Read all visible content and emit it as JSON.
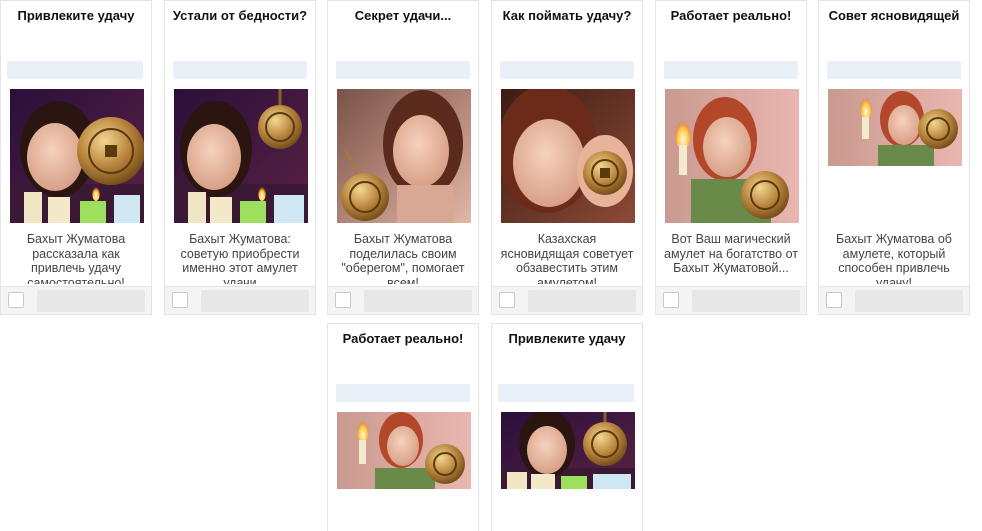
{
  "colors": {
    "card_border": "#e3e3e3",
    "footer_bg": "#f4f4f4",
    "url_placeholder": "#e9f0f8",
    "title_text": "#111111",
    "description_text": "#444444"
  },
  "ads": [
    {
      "title": "Привлеките удачу",
      "description": "Бахыт Жуматова рассказала как привлечь удачу самостоятельно!",
      "image": "woman-with-amulet-and-candles"
    },
    {
      "title": "Устали от бедности?",
      "description": "Бахыт Жуматова: советую приобрести именно этот амулет удачи",
      "image": "woman-with-amulet-and-candles"
    },
    {
      "title": "Секрет удачи...",
      "description": "Бахыт Жуматова поделилась своим \"оберегом\", помогает всем!",
      "image": "woman-holding-amulet-pendant"
    },
    {
      "title": "Как поймать удачу?",
      "description": "Казахская ясновидящая советует обзавестить этим амулетом!",
      "image": "woman-holding-amulet-closeup"
    },
    {
      "title": "Работает реально!",
      "description": "Вот Ваш магический амулет на богатство от Бахыт Жуматовой...",
      "image": "woman-with-candle-and-amulet"
    },
    {
      "title": "Совет ясновидящей",
      "description": "Бахыт Жуматова об амулете, который способен привлечь удачу!",
      "image": "woman-with-candle-and-amulet"
    },
    {
      "title": "Работает реально!",
      "description": "",
      "image": "woman-with-candle-and-amulet"
    },
    {
      "title": "Привлеките удачу",
      "description": "",
      "image": "woman-with-amulet-and-candles"
    }
  ]
}
